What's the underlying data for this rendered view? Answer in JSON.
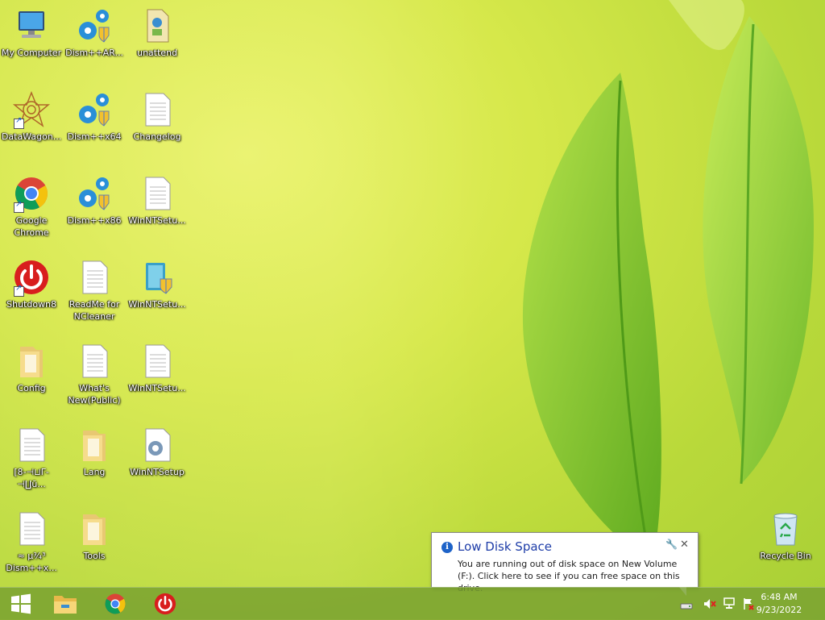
{
  "desktop": {
    "icons": [
      {
        "label": "My Computer"
      },
      {
        "label": "Dism++AR..."
      },
      {
        "label": "unattend"
      },
      {
        "label": "DataWagon..."
      },
      {
        "label": "Dism++x64"
      },
      {
        "label": "Changelog"
      },
      {
        "label": "Google Chrome"
      },
      {
        "label": "Dism++x86"
      },
      {
        "label": "WinNTSetu..."
      },
      {
        "label": "Shutdown8"
      },
      {
        "label": "ReadMe for NCleaner"
      },
      {
        "label": "WinNTSetu..."
      },
      {
        "label": "Config"
      },
      {
        "label": "What's New(Public)"
      },
      {
        "label": "WinNTSetu..."
      },
      {
        "label": "[8-⊣⊔Γ-⊣∐ū..."
      },
      {
        "label": "Lang"
      },
      {
        "label": "WinNTSetup"
      },
      {
        "label": "≈ µ¾³ Dism++x..."
      },
      {
        "label": "Tools"
      },
      {
        "label": "Recycle Bin"
      }
    ]
  },
  "notification": {
    "title": "Low Disk Space",
    "message": "You are running out of disk space on New Volume (F:). Click here to see if you can free space on this drive."
  },
  "taskbar": {
    "time": "6:48 AM",
    "date": "9/23/2022"
  },
  "colors": {
    "accent_blue": "#1e63c8",
    "taskbar": "#78a032",
    "chrome_red": "#db4437",
    "chrome_yellow": "#f4c20d",
    "chrome_green": "#0f9d58",
    "shutdown_red": "#d81e1e"
  }
}
